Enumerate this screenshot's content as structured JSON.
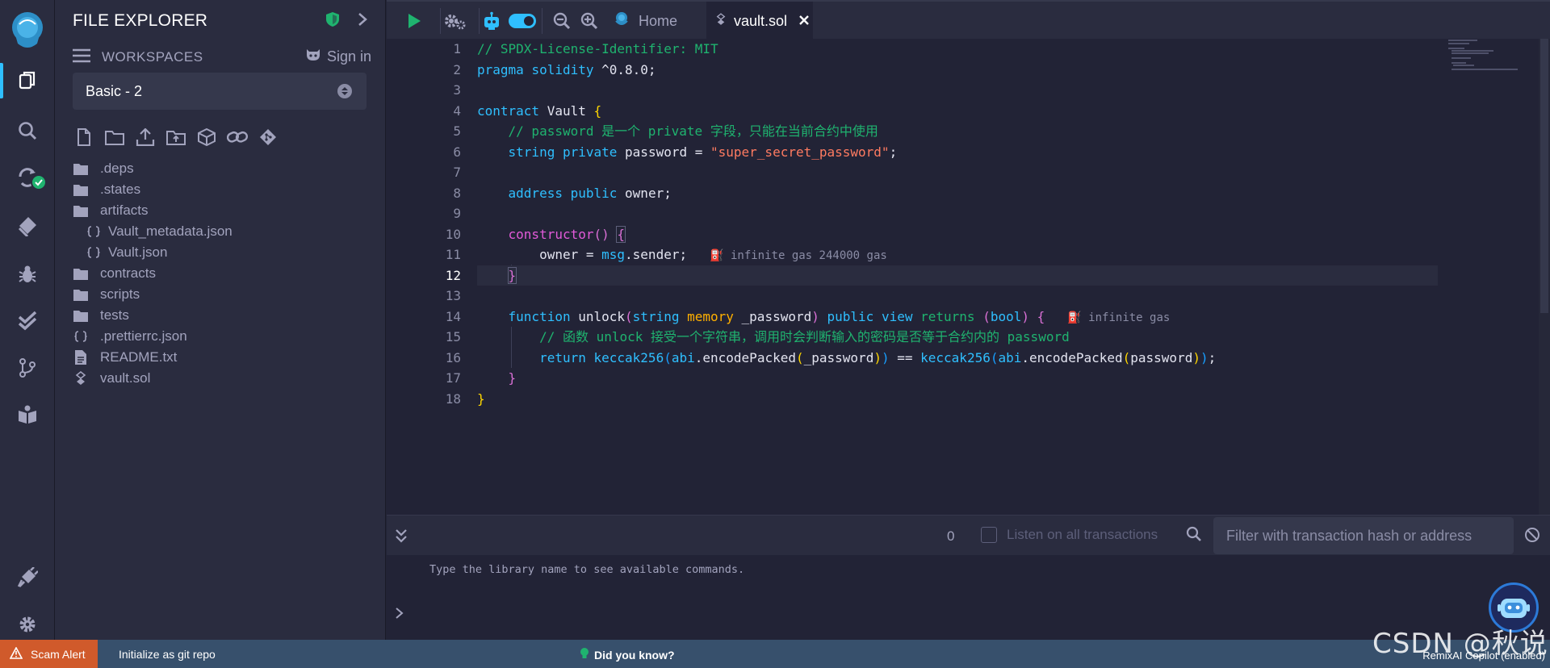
{
  "sidebar": {
    "title": "FILE EXPLORER",
    "workspaces_label": "WORKSPACES",
    "sign_in_label": "Sign in",
    "workspace_selected": "Basic - 2",
    "tree": [
      {
        "name": ".deps",
        "kind": "folder",
        "depth": 0
      },
      {
        "name": ".states",
        "kind": "folder",
        "depth": 0
      },
      {
        "name": "artifacts",
        "kind": "folder",
        "depth": 0
      },
      {
        "name": "Vault_metadata.json",
        "kind": "json",
        "depth": 1
      },
      {
        "name": "Vault.json",
        "kind": "json",
        "depth": 1
      },
      {
        "name": "contracts",
        "kind": "folder",
        "depth": 0
      },
      {
        "name": "scripts",
        "kind": "folder",
        "depth": 0
      },
      {
        "name": "tests",
        "kind": "folder",
        "depth": 0
      },
      {
        "name": ".prettierrc.json",
        "kind": "json",
        "depth": 0
      },
      {
        "name": "README.txt",
        "kind": "file",
        "depth": 0
      },
      {
        "name": "vault.sol",
        "kind": "sol",
        "depth": 0
      }
    ]
  },
  "tabs": {
    "home_label": "Home",
    "active_label": "vault.sol"
  },
  "editor": {
    "current_line": 12,
    "line_numbers": [
      "1",
      "2",
      "3",
      "4",
      "5",
      "6",
      "7",
      "8",
      "9",
      "10",
      "11",
      "12",
      "13",
      "14",
      "15",
      "16",
      "17",
      "18"
    ],
    "gas_line11": "infinite gas 244000 gas",
    "gas_line14": "infinite gas",
    "code": {
      "l1": "// SPDX-License-Identifier: MIT",
      "l2_a": "pragma",
      "l2_b": "solidity",
      "l2_c": " ^0.8.0;",
      "l4_a": "contract",
      "l4_b": " Vault ",
      "l4_c": "{",
      "l5": "    // password 是一个 private 字段，只能在当前合约中使用",
      "l6_a": "string",
      "l6_b": "private",
      "l6_c": " password = ",
      "l6_d": "\"super_secret_password\"",
      "l6_e": ";",
      "l8_a": "address",
      "l8_b": "public",
      "l8_c": " owner;",
      "l10_a": "constructor",
      "l10_b": "()",
      "l10_c": "{",
      "l11_a": "owner = ",
      "l11_b": "msg",
      "l11_c": ".sender;",
      "l12": "}",
      "l14_a": "function",
      "l14_b": " unlock",
      "l14_c": "(",
      "l14_d": "string",
      "l14_e": "memory",
      "l14_f": " _password",
      "l14_g": ")",
      "l14_h": "public",
      "l14_i": "view",
      "l14_j": "returns",
      "l14_k": "(",
      "l14_l": "bool",
      "l14_m": ")",
      "l14_n": "{",
      "l15": "        // 函数 unlock 接受一个字符串，调用时会判断输入的密码是否等于合约内的 password",
      "l16_a": "return",
      "l16_b": "keccak256",
      "l16_c": "(",
      "l16_d": "abi",
      "l16_e": ".encodePacked",
      "l16_f": "(",
      "l16_g": "_password",
      "l16_h": ")",
      "l16_i": ")",
      "l16_j": " == ",
      "l16_k": "keccak256",
      "l16_l": "(",
      "l16_m": "abi",
      "l16_n": ".encodePacked",
      "l16_o": "(",
      "l16_p": "password",
      "l16_q": ")",
      "l16_r": ")",
      "l16_s": ";",
      "l17": "}",
      "l18": "}"
    }
  },
  "terminal": {
    "tx_count": "0",
    "listen_label": "Listen on all transactions",
    "filter_placeholder": "Filter with transaction hash or address",
    "message": "Type the library name to see available commands.",
    "prompt": ">"
  },
  "statusbar": {
    "scam_alert": "Scam Alert",
    "git_init": "Initialize as git repo",
    "did_you_know": "Did you know?",
    "copilot": "RemixAI Copilot (enabled)"
  },
  "watermark": "CSDN @秋说",
  "colors": {
    "accent": "#2fbfff",
    "success": "#1fb36f",
    "scam": "#d05a2b",
    "status": "#37506c",
    "background": "#222336",
    "panel": "#2a2c3f"
  },
  "icons": [
    "remix-logo-icon",
    "file-explorer-icon",
    "search-icon",
    "solidity-compiler-icon",
    "check-badge-icon",
    "deploy-icon",
    "debugger-icon",
    "test-icon",
    "git-icon",
    "learneth-icon",
    "plugin-manager-icon",
    "settings-icon",
    "shield-icon",
    "chevron-right-icon",
    "hamburger-icon",
    "github-icon",
    "run-icon",
    "gear-icon",
    "robot-icon",
    "zoom-out-icon",
    "zoom-in-icon",
    "home-icon",
    "close-icon",
    "collapse-icon",
    "search-icon",
    "clear-icon",
    "warning-icon",
    "bulb-icon"
  ]
}
